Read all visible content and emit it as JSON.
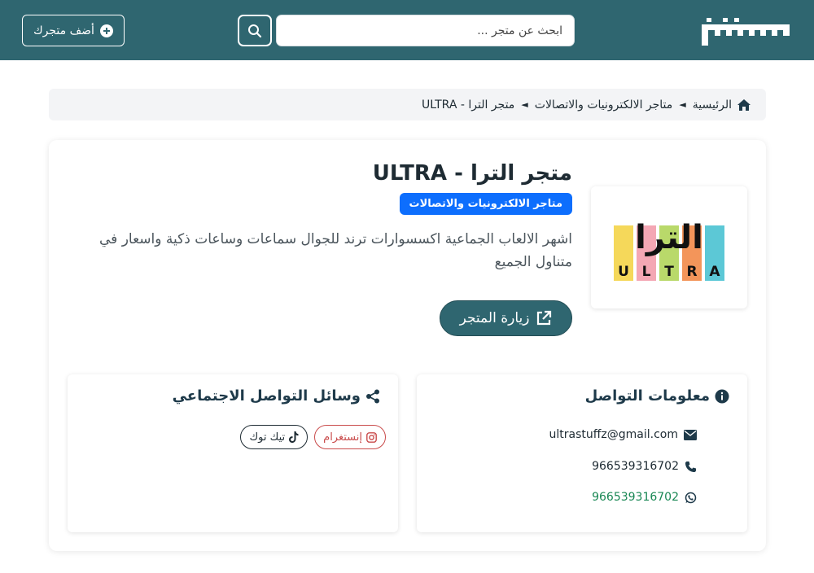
{
  "header": {
    "logo_text": "مشهور",
    "search_placeholder": "ابحث عن متجر ...",
    "add_store_label": "أضف متجرك",
    "brand_color": "#2f6670"
  },
  "breadcrumb": {
    "home": "الرئيسية",
    "category": "متاجر الالكترونيات والاتصالات",
    "current": "متجر الترا - ULTRA"
  },
  "store": {
    "title": "متجر الترا - ULTRA",
    "category_badge": "متاجر الالكترونيات والاتصالات",
    "description": "اشهر الالعاب الجماعية اكسسوارات ترند للجوال سماعات وساعات ذكية واسعار في متناول الجميع",
    "visit_label": "زيارة المتجر",
    "logo": {
      "arabic": "الترا",
      "letters": [
        "U",
        "L",
        "T",
        "R",
        "A"
      ],
      "colors": [
        "#f5d85a",
        "#f4a7b4",
        "#b9d96a",
        "#f3955a",
        "#5cc8d6"
      ]
    }
  },
  "contact": {
    "title": "معلومات التواصل",
    "email": "ultrastuffz@gmail.com",
    "phone": "966539316702",
    "whatsapp": "966539316702"
  },
  "social": {
    "title": "وسائل التواصل الاجتماعي",
    "instagram_label": "إنستغرام",
    "tiktok_label": "تيك توك"
  }
}
